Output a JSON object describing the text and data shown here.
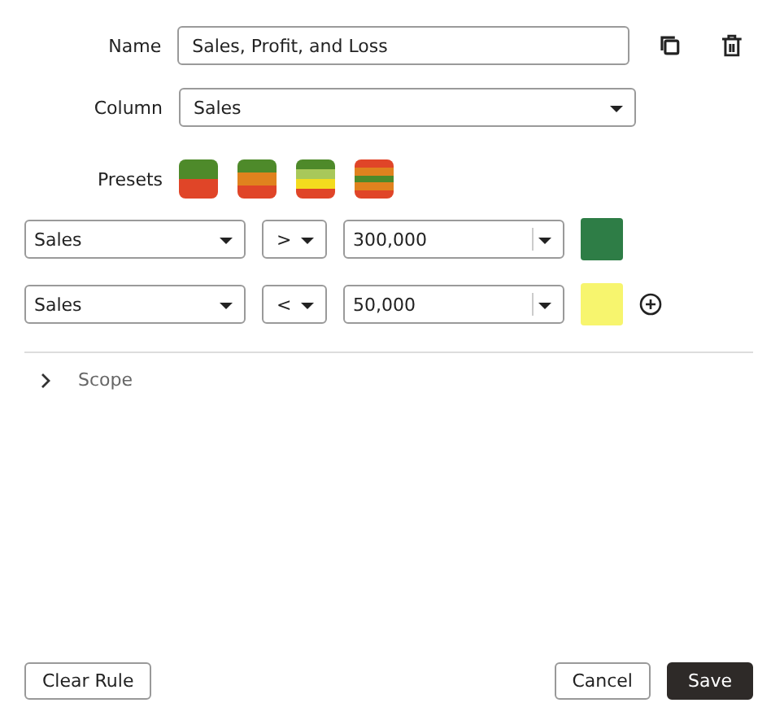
{
  "name": {
    "label": "Name",
    "value": "Sales, Profit, and Loss"
  },
  "column": {
    "label": "Column",
    "value": "Sales"
  },
  "presets": {
    "label": "Presets",
    "items": [
      {
        "stripes": [
          {
            "color": "#4e8a2a"
          },
          {
            "color": "#e04528"
          }
        ]
      },
      {
        "stripes": [
          {
            "color": "#4e8a2a"
          },
          {
            "color": "#e0821e"
          },
          {
            "color": "#e04528"
          }
        ]
      },
      {
        "stripes": [
          {
            "color": "#4e8a2a"
          },
          {
            "color": "#a8c85a"
          },
          {
            "color": "#f3dc1e"
          },
          {
            "color": "#e04528"
          }
        ]
      },
      {
        "stripes": [
          {
            "color": "#e04528"
          },
          {
            "color": "#e0821e"
          },
          {
            "color": "#4e8a2a"
          },
          {
            "color": "#e0821e"
          },
          {
            "color": "#e04528"
          }
        ]
      }
    ]
  },
  "rules": [
    {
      "column": "Sales",
      "operator": ">",
      "value": "300,000",
      "color": "#2e7d46"
    },
    {
      "column": "Sales",
      "operator": "<",
      "value": "50,000",
      "color": "#f7f56e"
    }
  ],
  "scope": {
    "label": "Scope",
    "expanded": false
  },
  "buttons": {
    "clear": "Clear Rule",
    "cancel": "Cancel",
    "save": "Save"
  }
}
